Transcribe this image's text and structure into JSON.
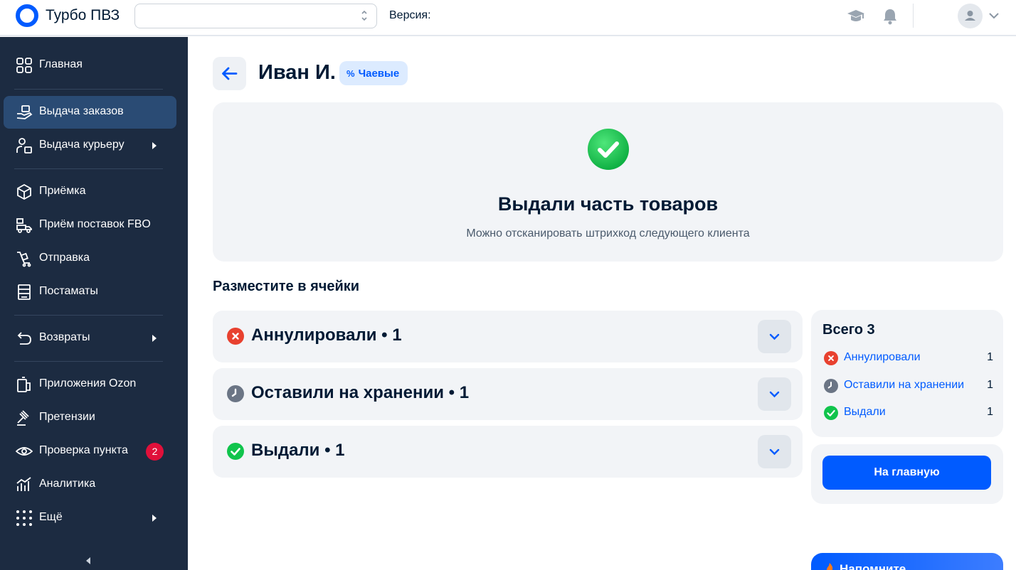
{
  "app": {
    "brand": "Турбо ПВЗ",
    "version_label": "Версия:",
    "select_value": ""
  },
  "sidebar": {
    "items": [
      {
        "label": "Главная",
        "icon": "grid-icon"
      },
      {
        "label": "Выдача заказов",
        "icon": "hand-box-icon",
        "active": true
      },
      {
        "label": "Выдача курьеру",
        "icon": "courier-icon",
        "submenu": true
      },
      {
        "label": "Приёмка",
        "icon": "box-icon"
      },
      {
        "label": "Приём поставок FBO",
        "icon": "truck-icon"
      },
      {
        "label": "Отправка",
        "icon": "cart-icon"
      },
      {
        "label": "Постаматы",
        "icon": "postamat-icon"
      },
      {
        "label": "Возвраты",
        "icon": "return-icon",
        "submenu": true
      },
      {
        "label": "Приложения Ozon",
        "icon": "apps-icon"
      },
      {
        "label": "Претензии",
        "icon": "gavel-icon"
      },
      {
        "label": "Проверка пункта",
        "icon": "eye-icon",
        "badge": "2"
      },
      {
        "label": "Аналитика",
        "icon": "chart-icon"
      },
      {
        "label": "Ещё",
        "icon": "dots-icon",
        "submenu": true
      }
    ]
  },
  "header": {
    "customer_name": "Иван И.",
    "tip_badge": "Чаевые",
    "tip_badge_icon": "%"
  },
  "success": {
    "title": "Выдали часть товаров",
    "subtitle": "Можно отсканировать штрихкод следующего клиента"
  },
  "cells": {
    "title": "Разместите в ячейки",
    "groups": [
      {
        "label": "Аннулировали • 1",
        "status": "cancelled"
      },
      {
        "label": "Оставили на хранении • 1",
        "status": "storage"
      },
      {
        "label": "Выдали • 1",
        "status": "issued"
      }
    ]
  },
  "summary": {
    "title": "Всего 3",
    "rows": [
      {
        "label": "Аннулировали",
        "count": "1",
        "status": "cancelled"
      },
      {
        "label": "Оставили на хранении",
        "count": "1",
        "status": "storage"
      },
      {
        "label": "Выдали",
        "count": "1",
        "status": "issued"
      }
    ],
    "home_button": "На главную"
  },
  "promo": {
    "text": "Напомните"
  },
  "colors": {
    "accent": "#005bff",
    "sidebar_bg": "#1c2b41",
    "sidebar_active": "#2a4b74",
    "cancelled": "#e8412f",
    "storage": "#6b7585",
    "issued": "#10c44c",
    "badge": "#e0103a"
  }
}
